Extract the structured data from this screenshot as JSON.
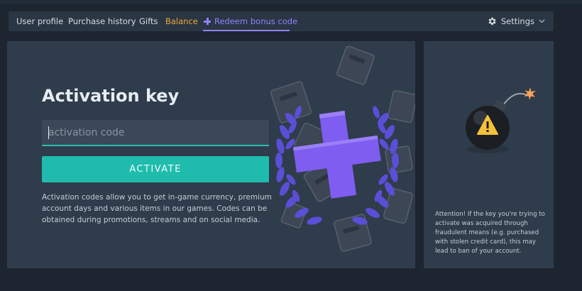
{
  "nav": {
    "items": [
      {
        "label": "User profile"
      },
      {
        "label": "Purchase history"
      },
      {
        "label": "Gifts"
      },
      {
        "label": "Balance"
      },
      {
        "label": "Redeem bonus code"
      }
    ],
    "active_icon": "plus-icon",
    "settings_label": "Settings",
    "settings_icon": "gear-icon",
    "settings_chevron": "chevron-down-icon"
  },
  "main": {
    "title": "Activation key",
    "input": {
      "placeholder": "activation code",
      "value": ""
    },
    "activate_label": "ACTIVATE",
    "description": "Activation codes allow you to get in-game currency, premium account days and various items in our games. Codes can be obtained during promotions, streams and on social media.",
    "illustration": "laurel-wreath-plus-icon"
  },
  "side": {
    "illustration": "bomb-warning-icon",
    "attention_text": "Attention! If the key you're trying to activate was acquired through fraudulent means (e.g. purchased with stolen credit card), this may lead to ban of your account."
  },
  "colors": {
    "background": "#1c2530",
    "panel": "#2f3c4b",
    "accent_teal": "#1fbcae",
    "accent_purple": "#8f83ff",
    "balance_orange": "#f0a63c"
  }
}
